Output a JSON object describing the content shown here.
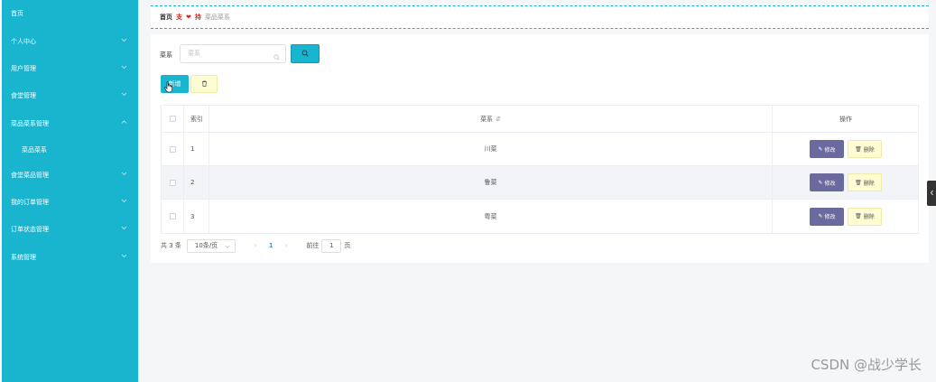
{
  "colors": {
    "accent": "#19b4cd",
    "edit": "#6a6a9e",
    "delete_bg": "#fdfcd3",
    "danger": "#e02020"
  },
  "sidebar": {
    "items": [
      {
        "label": "首页",
        "arrow": ""
      },
      {
        "label": "个人中心",
        "arrow": "chevron-down"
      },
      {
        "label": "用户管理",
        "arrow": "chevron-down"
      },
      {
        "label": "食堂管理",
        "arrow": "chevron-down"
      },
      {
        "label": "菜品菜系管理",
        "arrow": "chevron-up"
      },
      {
        "label": "菜品菜系",
        "arrow": ""
      },
      {
        "label": "食堂菜品管理",
        "arrow": "chevron-down"
      },
      {
        "label": "我的订单管理",
        "arrow": "chevron-down"
      },
      {
        "label": "订单状态管理",
        "arrow": "chevron-down"
      },
      {
        "label": "系统管理",
        "arrow": "chevron-down"
      }
    ]
  },
  "breadcrumb": {
    "home": "首页",
    "separator": "支",
    "separator2": "持",
    "current": "菜品菜系"
  },
  "search": {
    "label": "菜系",
    "placeholder": "菜系"
  },
  "toolbar": {
    "add_label": "新增"
  },
  "table": {
    "headers": {
      "index": "索引",
      "name": "菜系",
      "ops": "操作"
    },
    "rows": [
      {
        "index": "1",
        "name": "川菜"
      },
      {
        "index": "2",
        "name": "鲁菜"
      },
      {
        "index": "3",
        "name": "粤菜"
      }
    ],
    "edit_label": "修改",
    "delete_label": "删除"
  },
  "pager": {
    "total": "共 3 条",
    "page_size": "10条/页",
    "current": "1",
    "goto_label": "前往",
    "goto_value": "1",
    "page_suffix": "页"
  },
  "watermark": "CSDN @战少学长"
}
